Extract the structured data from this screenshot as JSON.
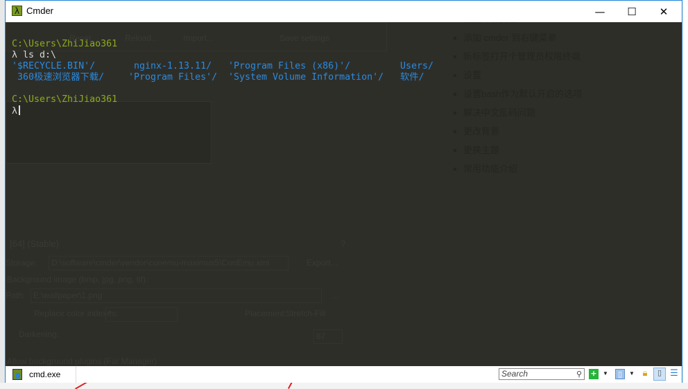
{
  "window": {
    "title": "Cmder",
    "minimize_label": "—",
    "maximize_label": "☐",
    "close_label": "✕"
  },
  "terminal": {
    "lines": [
      {
        "type": "path",
        "text": "C:\\Users\\ZhiJiao361"
      },
      {
        "type": "command",
        "prompt": "λ",
        "text": "ls d:\\"
      },
      {
        "type": "listing",
        "cells": [
          "'$RECYCLE.BIN'/",
          "nginx-1.13.11/",
          "'Program Files (x86)'/",
          "Users/"
        ]
      },
      {
        "type": "listing",
        "cells": [
          " 360极速浏览器下载/",
          "'Program Files'/",
          "'System Volume Information'/",
          "软件/"
        ]
      },
      {
        "type": "blank",
        "text": ""
      },
      {
        "type": "path",
        "text": "C:\\Users\\ZhiJiao361"
      },
      {
        "type": "command",
        "prompt": "λ",
        "text": ""
      }
    ],
    "colors": {
      "background": "#2e2e29",
      "path": "#8cab1c",
      "text": "#d8d8d8",
      "directory": "#2a8be0"
    }
  },
  "background_windows": {
    "buttons": [
      "Reset...",
      "Reload...",
      "Import...",
      "Save settings"
    ],
    "dialog_title": "[64] (Stable)",
    "storage_label": "Storage:",
    "storage_value": "D:\\software\\cmder\\vendor\\conemu-maximus5\\ConEmu.xml",
    "export_label": "Export...",
    "bg_image_label": "Background image (bmp, jpg, png, tif):",
    "path_label": "Path:",
    "path_value": "E:\\wallpaper\\1.png",
    "browse_label": "...",
    "replace_label": "Replace color indexes:",
    "replace_value": "*",
    "placement_label": "Placement:",
    "placement_value": "Stretch-Fill",
    "darkening_label": "Darkening:",
    "darkening_value": "87",
    "plugins_label": "Allow background plugins (Far Manager)",
    "help_label": "?",
    "toc": [
      "配置环境变量",
      "添加 cmder 到右键菜单",
      "新标签打开个管理员权限终端",
      "设置",
      "设置bash作为默认开启的选项",
      "解决中文乱码问题",
      "更改背景",
      "更换主题",
      "常用功能介绍"
    ]
  },
  "statusbar": {
    "tab_label": "cmd.exe",
    "search_placeholder": "Search",
    "new_console_icon": "plus-icon",
    "lock_icon": "lock-icon"
  }
}
